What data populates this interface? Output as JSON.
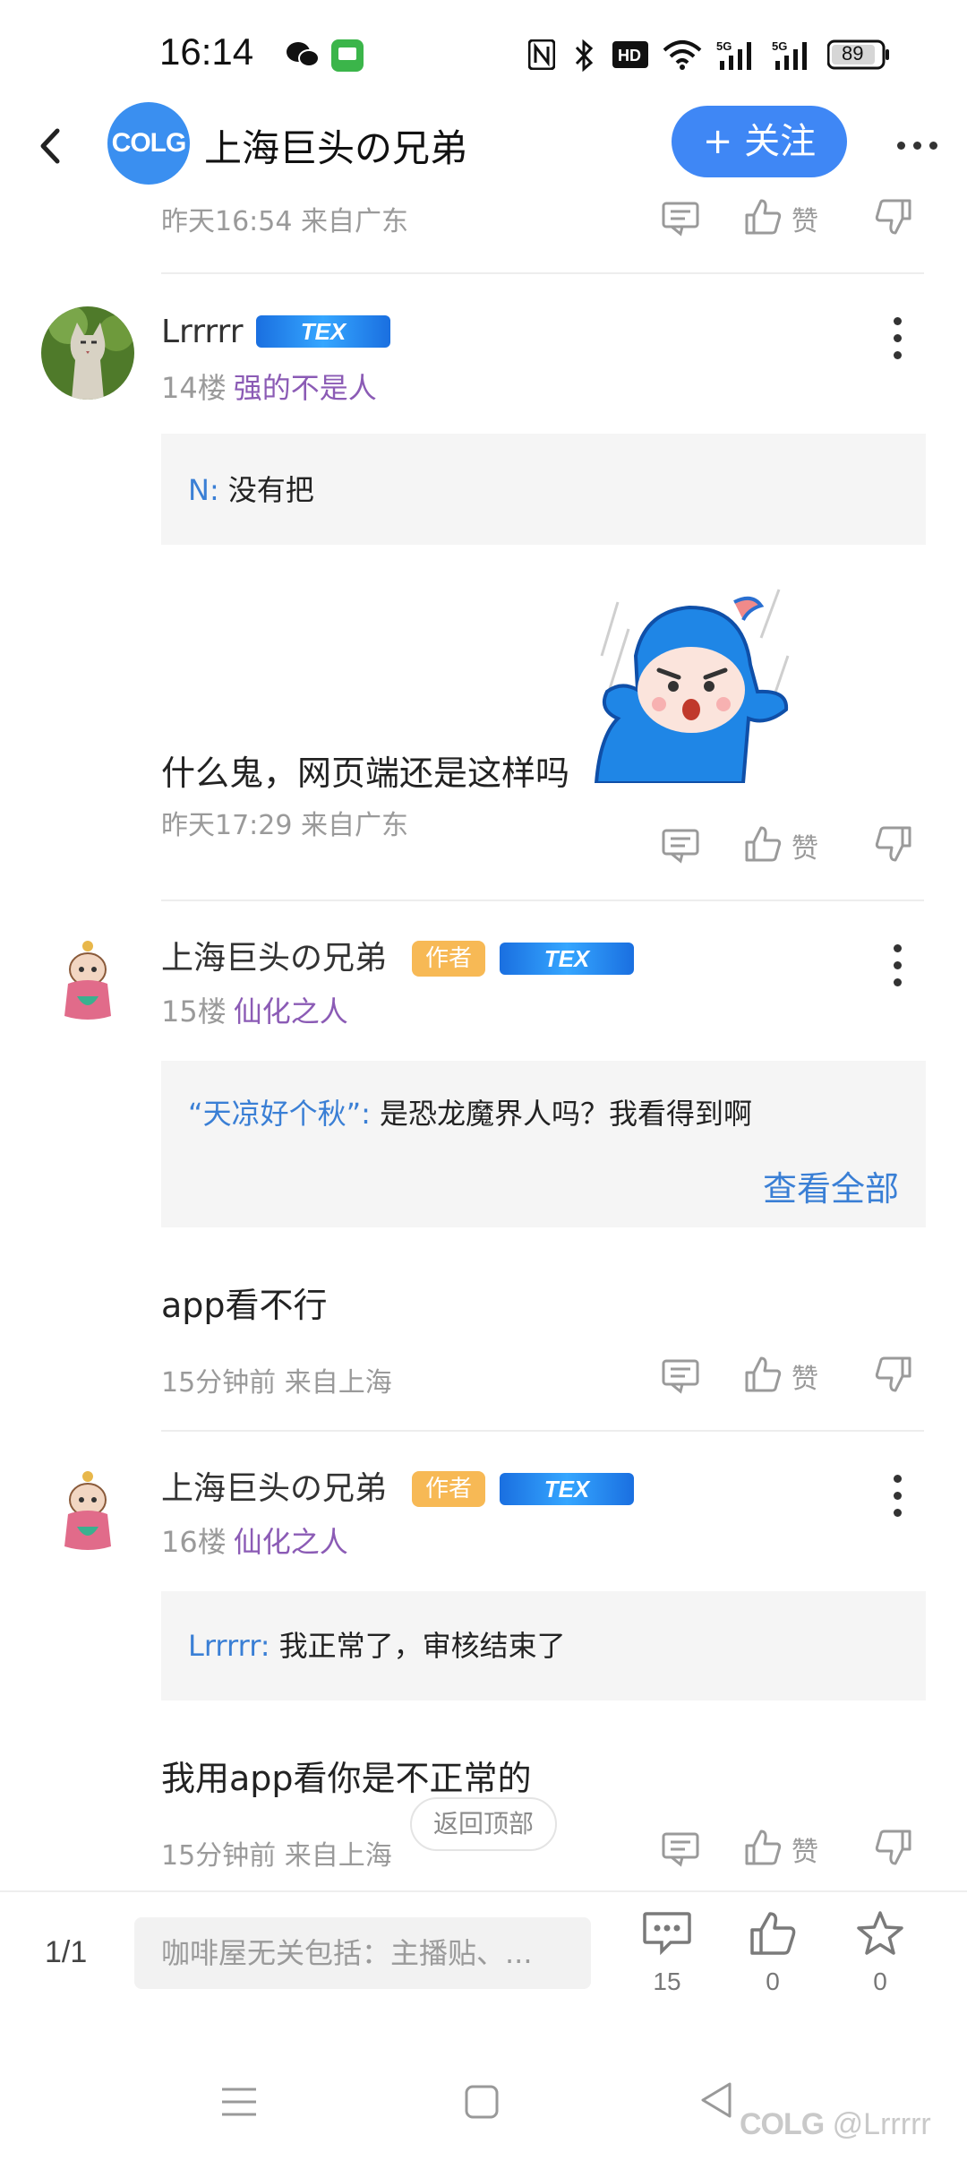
{
  "status_bar": {
    "time": "16:14",
    "battery": "89",
    "icons": [
      "wechat-icon",
      "message-app-icon",
      "nfc-icon",
      "bluetooth-icon",
      "hd-icon",
      "wifi-icon",
      "signal-5g-icon",
      "signal-5g-icon",
      "battery-icon"
    ]
  },
  "header": {
    "logo_text": "COLG",
    "title": "上海巨头の兄弟",
    "follow_label": "+ 关注"
  },
  "posts": [
    {
      "meta": "昨天16:54 来自广东",
      "like_label": "赞"
    },
    {
      "username": "Lrrrrr",
      "level_badge": "TEX",
      "floor": "14楼",
      "user_title": "强的不是人",
      "quote_name": "N:",
      "quote_text": "没有把",
      "text": "什么鬼，网页端还是这样吗",
      "meta": "昨天17:29 来自广东",
      "like_label": "赞"
    },
    {
      "username": "上海巨头の兄弟",
      "author_badge": "作者",
      "level_badge": "TEX",
      "floor": "15楼",
      "user_title": "仙化之人",
      "quote_name": "“天凉好个秋”:",
      "quote_text": "是恐龙魔界人吗？我看得到啊",
      "view_all": "查看全部",
      "text": "app看不行",
      "meta": "15分钟前 来自上海",
      "like_label": "赞"
    },
    {
      "username": "上海巨头の兄弟",
      "author_badge": "作者",
      "level_badge": "TEX",
      "floor": "16楼",
      "user_title": "仙化之人",
      "quote_name": "Lrrrrr:",
      "quote_text": "我正常了，审核结束了",
      "text": "我用app看你是不正常的",
      "meta": "15分钟前 来自上海",
      "like_label": "赞"
    }
  ],
  "back_to_top": "返回顶部",
  "bottom_bar": {
    "page": "1/1",
    "input_placeholder": "咖啡屋无关包括：主播贴、...",
    "comment_count": "15",
    "like_count": "0",
    "star_count": "0"
  },
  "watermark": {
    "brand": "COLG",
    "handle": "@Lrrrrr"
  },
  "colors": {
    "accent": "#3f87f5",
    "link": "#3a7fd5",
    "user_title": "#8b5bb5",
    "author_badge": "#f7b955"
  }
}
